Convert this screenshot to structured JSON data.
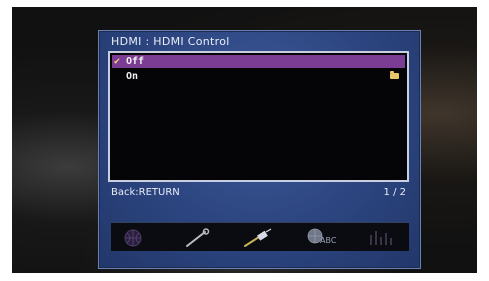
{
  "screen": {
    "title": "HDMI : HDMI Control"
  },
  "options": [
    {
      "label": "Off",
      "selected": true,
      "check_icon": "check-icon"
    },
    {
      "label": "On",
      "selected": false,
      "trailing_icon": "folder-icon"
    }
  ],
  "footer": {
    "back_hint": "Back:RETURN",
    "page_indicator": "1 / 2"
  },
  "iconbar": {
    "icons": [
      "globe-icon",
      "wrench-icon",
      "cable-plug-icon",
      "abc-language-icon",
      "equalizer-icon"
    ],
    "abc_label": "ABC"
  },
  "colors": {
    "panel_bg": "#2c4580",
    "selection": "#7b3c93",
    "text": "#e8ecf6",
    "check": "#f3d27a"
  }
}
